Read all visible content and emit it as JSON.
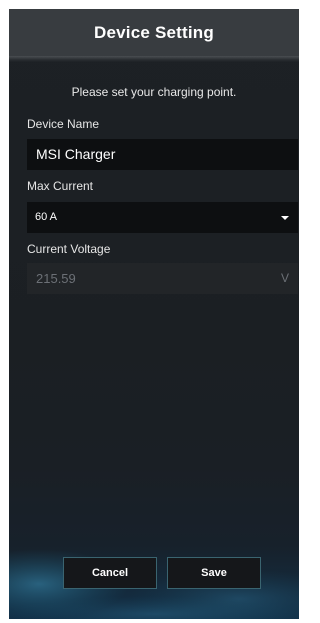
{
  "dialog": {
    "title": "Device Setting",
    "intro": "Please set your charging point."
  },
  "device_name": {
    "label": "Device Name",
    "value": "MSI Charger"
  },
  "max_current": {
    "label": "Max Current",
    "selected": "60 A"
  },
  "current_voltage": {
    "label": "Current Voltage",
    "value": "215.59",
    "unit": "V"
  },
  "buttons": {
    "cancel": "Cancel",
    "save": "Save"
  },
  "colors": {
    "header": "#383c40",
    "background": "#1c2024",
    "input_background": "#0d0f11",
    "accent_glow": "#1e6f8f"
  }
}
